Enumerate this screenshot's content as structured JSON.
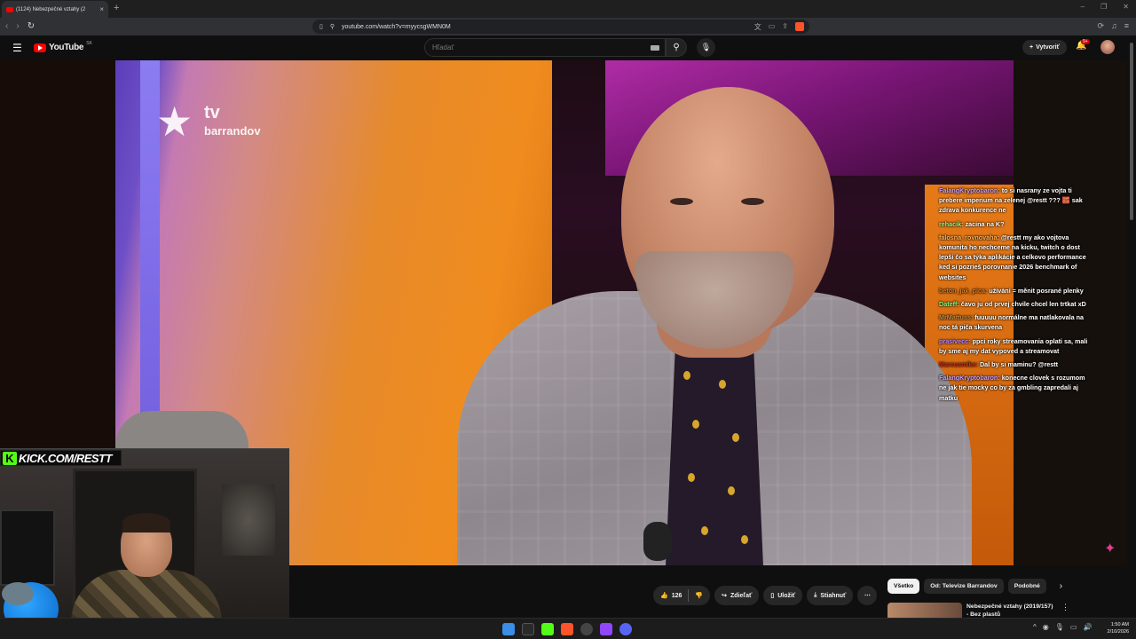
{
  "browser": {
    "tab_title": "(1124) Nebezpečné vztahy (2",
    "tab_close": "×",
    "new_tab": "+",
    "url": "youtube.com/watch?v=myycsgWMN0M",
    "window_controls": [
      "–",
      "❐",
      "✕"
    ]
  },
  "youtube": {
    "logo_text": "YouTube",
    "region": "SK",
    "search_placeholder": "Hľadať",
    "create_label": "Vytvoriť",
    "notification_count": "9+"
  },
  "video": {
    "channel_logo_tv": "tv",
    "channel_logo_name": "barrandov",
    "overlay_kick": "KICK.COM/RESTT"
  },
  "chat": [
    {
      "user": "FalangKryptobaron:",
      "user_color": "#c9a0ff",
      "text": "to si nasrany ze vojta ti prebere imperium na zelenej @restt ??? 🧱 sak zdrava konkurence ne"
    },
    {
      "user": "rehacik:",
      "user_color": "#9bff7a",
      "text": "zacina na K?"
    },
    {
      "user": "falosna_rovnovaha:",
      "user_color": "#ffb35c",
      "text": "@restt my ako vojtova komunita ho nechceme na kicku, twitch o dost lepši čo sa týka aplikácie a celkovo performance ked si pozrieš porovnanie 2026 benchmark of websites"
    },
    {
      "user": "beton_jak_pica:",
      "user_color": "#d27b2a",
      "text": "užívání = měnit posrané plenky"
    },
    {
      "user": "Dateff:",
      "user_color": "#7cff7c",
      "text": "čavo ju od prvej chvile chcel len trtkat xD"
    },
    {
      "user": "MrMattuss:",
      "user_color": "#c08a4a",
      "text": "fuuuuu normálne ma natlakovala na noc tá piča skurvena"
    },
    {
      "user": "prasivecc:",
      "user_color": "#b48cff",
      "text": "ppci roky streamovania oplati sa, mali by sme aj my dat vypoved a streamovat"
    },
    {
      "user": "Marcusmike:",
      "user_color": "#d0281f",
      "text": "Dal by si maminu? @restt"
    },
    {
      "user": "FalangKryptobaron:",
      "user_color": "#c9a0ff",
      "text": "konecne clovek s rozumom ne jak tie mocky co by za gmbling zapredali aj matku"
    }
  ],
  "actions": {
    "like_count": "126",
    "share_label": "Zdieľať",
    "save_label": "Uložiť",
    "download_label": "Stiahnuť",
    "more_label": "⋯"
  },
  "chips": [
    "Všetko",
    "Od: Televize Barrandov",
    "Podobné"
  ],
  "recommendation": {
    "title": "Nebezpečné vztahy (2019/157) - Bez plastů"
  },
  "clock": {
    "time": "1:50 AM",
    "date": "2/10/2026"
  },
  "colors": {
    "accent": "#ff0000",
    "kick_green": "#53fc18"
  }
}
